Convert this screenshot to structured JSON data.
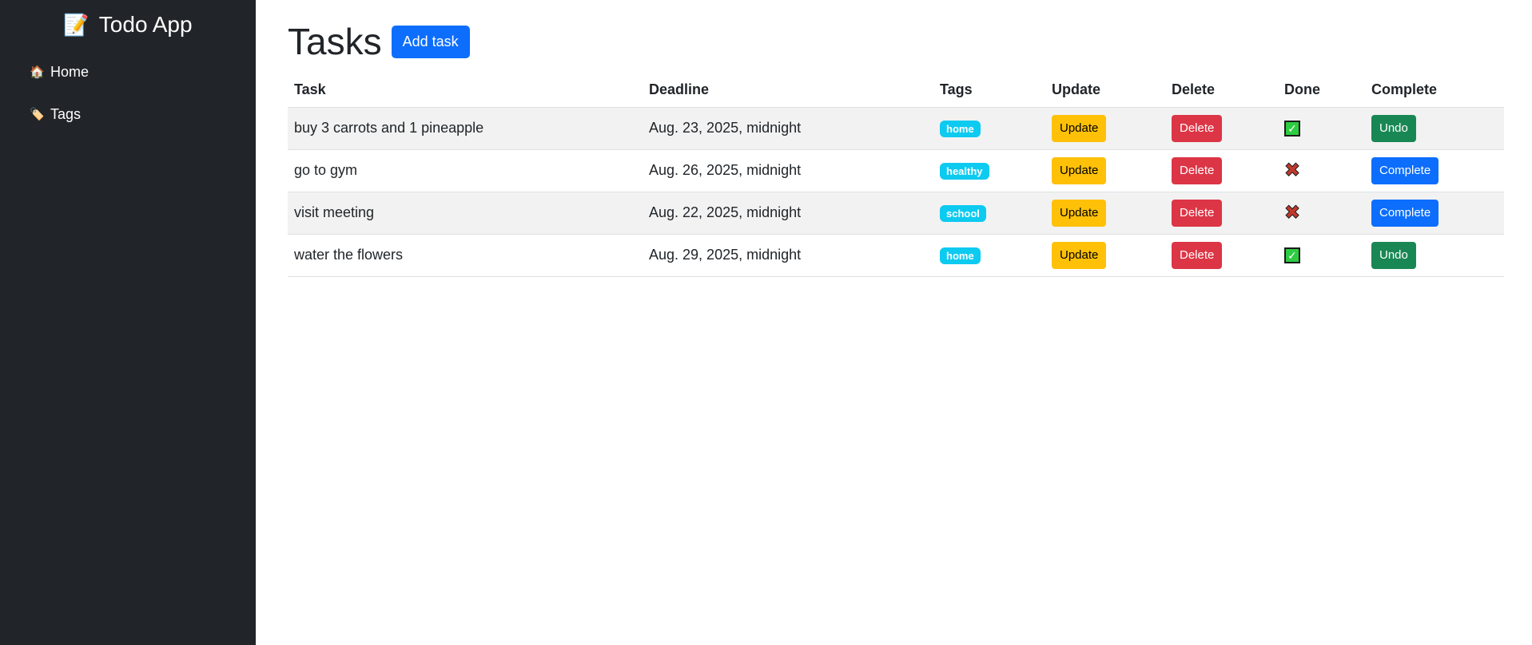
{
  "sidebar": {
    "brand": {
      "icon": "📝",
      "title": "Todo App"
    },
    "items": [
      {
        "icon": "🏠",
        "label": "Home"
      },
      {
        "icon": "🏷️",
        "label": "Tags"
      }
    ]
  },
  "main": {
    "title": "Tasks",
    "add_button": "Add task",
    "columns": [
      "Task",
      "Deadline",
      "Tags",
      "Update",
      "Delete",
      "Done",
      "Complete"
    ],
    "rows": [
      {
        "task": "buy 3 carrots and 1 pineapple",
        "deadline": "Aug. 23, 2025, midnight",
        "tag": "home",
        "update": "Update",
        "delete": "Delete",
        "done": true,
        "action": "Undo"
      },
      {
        "task": "go to gym",
        "deadline": "Aug. 26, 2025, midnight",
        "tag": "healthy",
        "update": "Update",
        "delete": "Delete",
        "done": false,
        "action": "Complete"
      },
      {
        "task": "visit meeting",
        "deadline": "Aug. 22, 2025, midnight",
        "tag": "school",
        "update": "Update",
        "delete": "Delete",
        "done": false,
        "action": "Complete"
      },
      {
        "task": "water the flowers",
        "deadline": "Aug. 29, 2025, midnight",
        "tag": "home",
        "update": "Update",
        "delete": "Delete",
        "done": true,
        "action": "Undo"
      }
    ],
    "done_icons": {
      "true": "check-mark-icon",
      "false": "cross-mark-icon"
    }
  },
  "colors": {
    "sidebar_bg": "#212529",
    "primary": "#0d6efd",
    "warning": "#ffc107",
    "danger": "#dc3545",
    "success": "#198754",
    "info": "#0dcaf0"
  }
}
